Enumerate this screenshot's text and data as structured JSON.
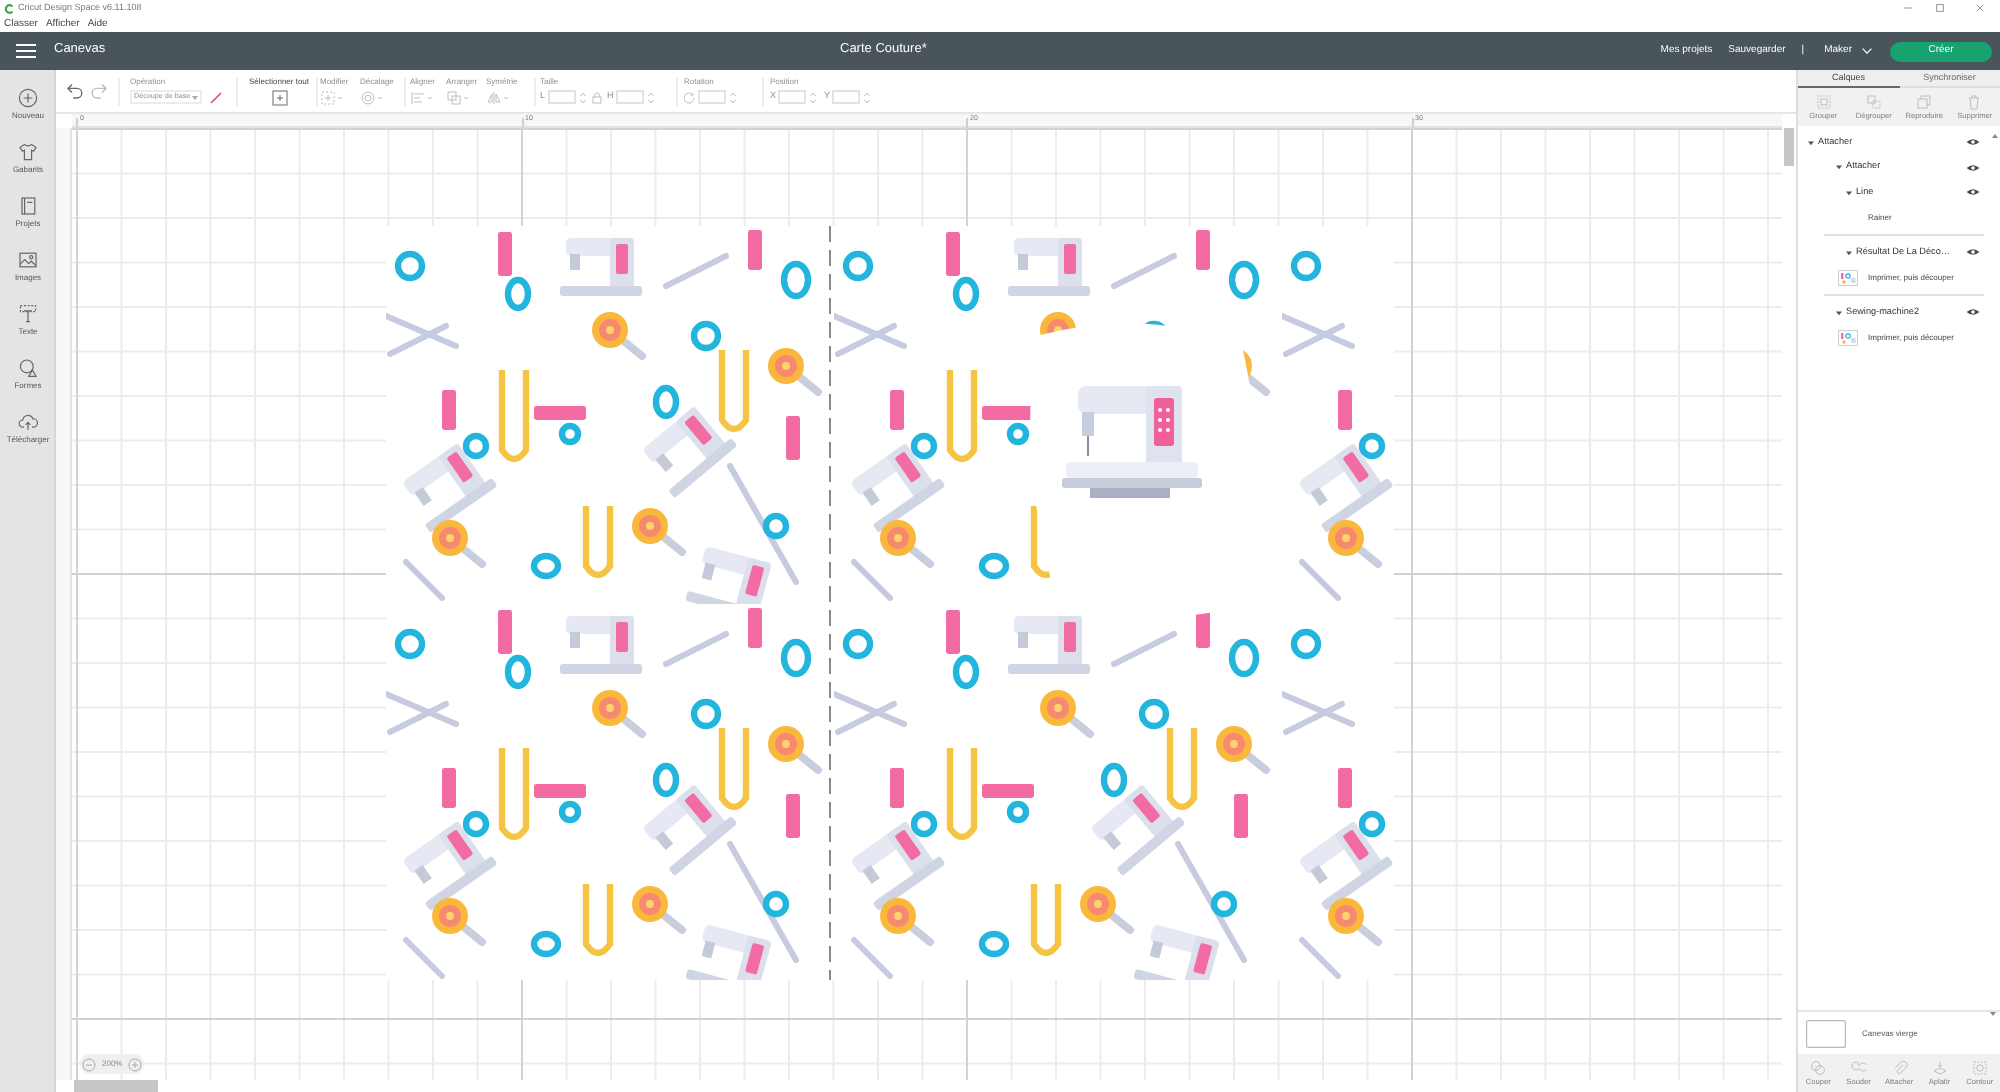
{
  "title_bar": {
    "title": "Cricut Design Space v6.11.108"
  },
  "menu_bar": [
    "Classer",
    "Afficher",
    "Aide"
  ],
  "header": {
    "section": "Canevas",
    "project_title": "Carte Couture*",
    "links": [
      "Mes projets",
      "Sauvegarder"
    ],
    "separator": "|",
    "machine": "Maker",
    "make_button": "Créer"
  },
  "sidebar": [
    {
      "kind": "new",
      "label": "Nouveau"
    },
    {
      "kind": "templates",
      "label": "Gabarits"
    },
    {
      "kind": "projects",
      "label": "Projets"
    },
    {
      "kind": "images",
      "label": "Images"
    },
    {
      "kind": "text",
      "label": "Texte"
    },
    {
      "kind": "shapes",
      "label": "Formes"
    },
    {
      "kind": "upload",
      "label": "Télécharger"
    }
  ],
  "toolbar": {
    "history": [
      {
        "kind": "undo",
        "disabled": false
      },
      {
        "kind": "redo",
        "disabled": true
      }
    ],
    "operation": {
      "label": "Opération",
      "value": "Découpe de base",
      "disabled": true
    },
    "select_all": {
      "label": "Sélectionner tout",
      "disabled": false
    },
    "tools": [
      {
        "kind": "edit",
        "label": "Modifier",
        "disabled": true
      },
      {
        "kind": "offset",
        "label": "Décalage",
        "disabled": true
      },
      {
        "kind": "align",
        "label": "Aligner",
        "disabled": true
      },
      {
        "kind": "arrange",
        "label": "Arranger",
        "disabled": true
      },
      {
        "kind": "flip",
        "label": "Symétrie",
        "disabled": true
      }
    ],
    "size": {
      "label": "Taille",
      "width_label": "L",
      "height_label": "H",
      "disabled": true
    },
    "rotation": {
      "label": "Rotation",
      "disabled": true
    },
    "position": {
      "label": "Position",
      "x_label": "X",
      "y_label": "Y",
      "disabled": true
    }
  },
  "ruler": {
    "labels": [
      "0",
      "10",
      "20",
      "30"
    ]
  },
  "canvas": {
    "zoom": "200%"
  },
  "layers_panel": {
    "tabs": [
      {
        "label": "Calques",
        "selected": true
      },
      {
        "label": "Synchroniser",
        "selected": false
      }
    ],
    "actions": [
      {
        "kind": "group",
        "label": "Grouper",
        "disabled": true
      },
      {
        "kind": "ungroup",
        "label": "Dégrouper",
        "disabled": true
      },
      {
        "kind": "duplicate",
        "label": "Reproduire",
        "disabled": true
      },
      {
        "kind": "delete",
        "label": "Supprimer",
        "disabled": true
      }
    ],
    "layers": [
      {
        "kind": "group",
        "name": "Attacher",
        "expanded": true,
        "visible": true,
        "children": [
          {
            "kind": "group",
            "name": "Attacher",
            "expanded": true,
            "visible": true,
            "children": [
              {
                "kind": "group",
                "name": "Line",
                "expanded": true,
                "visible": true,
                "children": [
                  {
                    "kind": "score",
                    "name": "Rainer"
                  }
                ]
              },
              {
                "kind": "group",
                "name": "Résultat De La Déco…",
                "expanded": true,
                "visible": true,
                "children": [
                  {
                    "kind": "print_then_cut",
                    "name": "Imprimer, puis découper"
                  }
                ]
              }
            ]
          },
          {
            "kind": "group",
            "name": "Sewing-machine2",
            "expanded": true,
            "visible": true,
            "children": [
              {
                "kind": "print_then_cut",
                "name": "Imprimer, puis découper"
              }
            ]
          }
        ]
      }
    ],
    "blank_canvas": {
      "label": "Canevas vierge"
    },
    "bottom_actions": [
      {
        "kind": "slice",
        "label": "Couper",
        "disabled": true
      },
      {
        "kind": "weld",
        "label": "Souder",
        "disabled": true
      },
      {
        "kind": "attach",
        "label": "Attacher",
        "disabled": true
      },
      {
        "kind": "flatten",
        "label": "Aplatir",
        "disabled": true
      },
      {
        "kind": "contour",
        "label": "Contour",
        "disabled": true
      }
    ]
  }
}
